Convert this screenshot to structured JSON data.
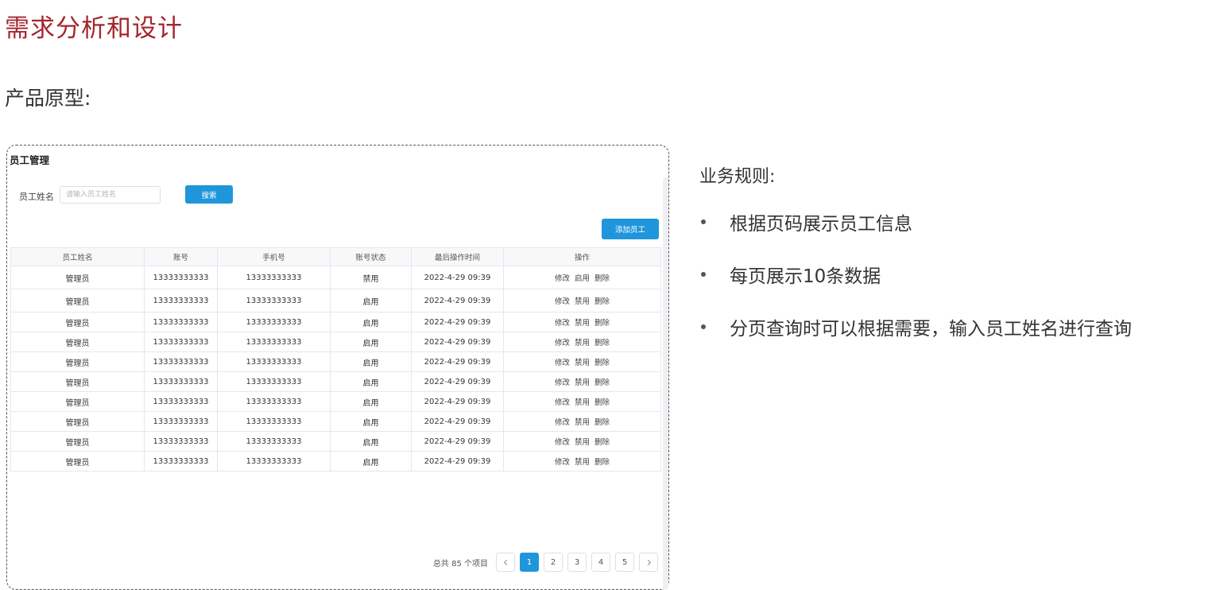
{
  "slide": {
    "title": "需求分析和设计",
    "subtitle": "产品原型:"
  },
  "prototype": {
    "title": "员工管理",
    "search": {
      "label": "员工姓名",
      "placeholder": "请输入员工姓名",
      "button": "搜索"
    },
    "add_button": "添加员工",
    "table": {
      "headers": [
        "员工姓名",
        "账号",
        "手机号",
        "账号状态",
        "最后操作时间",
        "操作"
      ],
      "rows": [
        {
          "name": "管理员",
          "account": "13333333333",
          "phone": "13333333333",
          "status": "禁用",
          "time": "2022-4-29 09:39",
          "ops": [
            "修改",
            "启用",
            "删除"
          ]
        },
        {
          "name": "管理员",
          "account": "13333333333",
          "phone": "13333333333",
          "status": "启用",
          "time": "2022-4-29 09:39",
          "ops": [
            "修改",
            "禁用",
            "删除"
          ]
        },
        {
          "name": "管理员",
          "account": "13333333333",
          "phone": "13333333333",
          "status": "启用",
          "time": "2022-4-29 09:39",
          "ops": [
            "修改",
            "禁用",
            "删除"
          ]
        },
        {
          "name": "管理员",
          "account": "13333333333",
          "phone": "13333333333",
          "status": "启用",
          "time": "2022-4-29 09:39",
          "ops": [
            "修改",
            "禁用",
            "删除"
          ]
        },
        {
          "name": "管理员",
          "account": "13333333333",
          "phone": "13333333333",
          "status": "启用",
          "time": "2022-4-29 09:39",
          "ops": [
            "修改",
            "禁用",
            "删除"
          ]
        },
        {
          "name": "管理员",
          "account": "13333333333",
          "phone": "13333333333",
          "status": "启用",
          "time": "2022-4-29 09:39",
          "ops": [
            "修改",
            "禁用",
            "删除"
          ]
        },
        {
          "name": "管理员",
          "account": "13333333333",
          "phone": "13333333333",
          "status": "启用",
          "time": "2022-4-29 09:39",
          "ops": [
            "修改",
            "禁用",
            "删除"
          ]
        },
        {
          "name": "管理员",
          "account": "13333333333",
          "phone": "13333333333",
          "status": "启用",
          "time": "2022-4-29 09:39",
          "ops": [
            "修改",
            "禁用",
            "删除"
          ]
        },
        {
          "name": "管理员",
          "account": "13333333333",
          "phone": "13333333333",
          "status": "启用",
          "time": "2022-4-29 09:39",
          "ops": [
            "修改",
            "禁用",
            "删除"
          ]
        },
        {
          "name": "管理员",
          "account": "13333333333",
          "phone": "13333333333",
          "status": "启用",
          "time": "2022-4-29 09:39",
          "ops": [
            "修改",
            "禁用",
            "删除"
          ]
        }
      ]
    },
    "pagination": {
      "total_text": "总共 85 个项目",
      "pages": [
        "1",
        "2",
        "3",
        "4",
        "5"
      ],
      "current": "1",
      "prev_icon": "chevron-left-icon",
      "next_icon": "chevron-right-icon"
    },
    "accent_color": "#1f96db"
  },
  "rules": {
    "title": "业务规则:",
    "items": [
      "根据页码展示员工信息",
      "每页展示10条数据",
      "分页查询时可以根据需要，输入员工姓名进行查询"
    ]
  },
  "colors": {
    "title": "#a4262c"
  }
}
